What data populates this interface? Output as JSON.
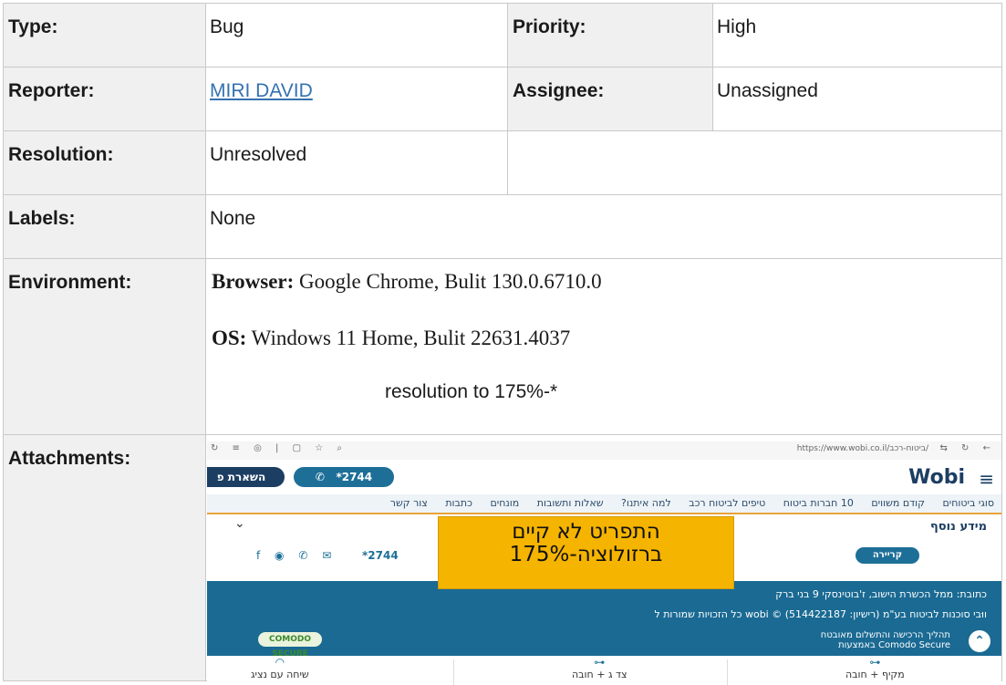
{
  "fields": {
    "type_label": "Type:",
    "type_value": "Bug",
    "priority_label": "Priority:",
    "priority_value": "High",
    "reporter_label": "Reporter:",
    "reporter_value": "MIRI DAVID",
    "assignee_label": "Assignee:",
    "assignee_value": "Unassigned",
    "resolution_label": "Resolution:",
    "resolution_value": "Unresolved",
    "labels_label": "Labels:",
    "labels_value": "None",
    "environment_label": "Environment:",
    "attachments_label": "Attachments:"
  },
  "environment": {
    "browser_key": "Browser:",
    "browser_value": " Google Chrome, Bulit 130.0.6710.0",
    "os_key": "OS:",
    "os_value": " Windows 11 Home, Bulit 22631.4037",
    "resolution_note": "resolution to 175%-*"
  },
  "attachment": {
    "url": "https://www.wobi.co.il/ביטוח-רכב/",
    "btn_dark": "השארת פ",
    "btn_phone": "*2744",
    "logo": "Wobi",
    "nav": [
      "סוגי ביטוחים",
      "קודם משווים",
      "10 חברות ביטוח",
      "טיפים לביטוח רכב",
      "למה איתנו?",
      "שאלות ותשובות",
      "מונחים",
      "כתבות",
      "צור קשר"
    ],
    "more_info": "מידע נוסף",
    "call_btn": "קריירה",
    "phone": "*2744",
    "address": "כתובת: ממל הכשרת הישוב, ז'בוטינסקי 9 בני ברק",
    "rights": "כל הזכויות שמורות ל wobi © ווּבי סוכנות לביטוח בע\"מ (רישיון: 514422187)",
    "secure_line1": "תהליך הרכישה והתשלום מאובטח",
    "secure_line2": "באמצעות Comodo Secure",
    "comodo": "COMODO SECURE",
    "bottom": [
      "שיחה עם נציג",
      "צד ג + חובה",
      "מקיף + חובה"
    ],
    "callout_line1": "התפריט לא קיים",
    "callout_line2": "ברזולוציה-175%"
  }
}
